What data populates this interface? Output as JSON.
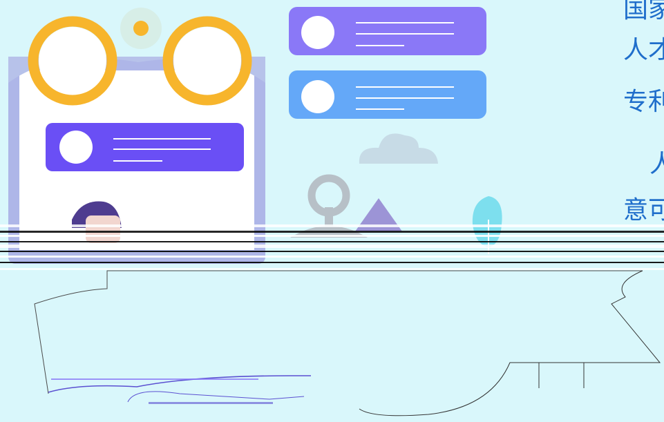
{
  "colors": {
    "background": "#d9f7fb",
    "card_frame": "#aeb6e8",
    "accent_orange": "#f7b52c",
    "purple": "#6a4ff5",
    "violet": "#8a78f7",
    "blue": "#64a8f8",
    "cloud": "#c7dbe6",
    "gray_icon": "#b7c0c7",
    "triangle": "#9c94d6",
    "teal_tree": "#7ddfee",
    "text_blue": "#1f6ecb"
  },
  "side_text": {
    "line1": "国家",
    "line2": "人才",
    "line3": "专利",
    "line4": "人",
    "line5": "意可"
  },
  "icons": {
    "binoculars": "binoculars-icon",
    "avatar": "avatar-icon",
    "cloud": "cloud-icon",
    "location_pin": "location-pin-icon",
    "mountain": "triangle-icon",
    "tree": "tree-icon"
  }
}
